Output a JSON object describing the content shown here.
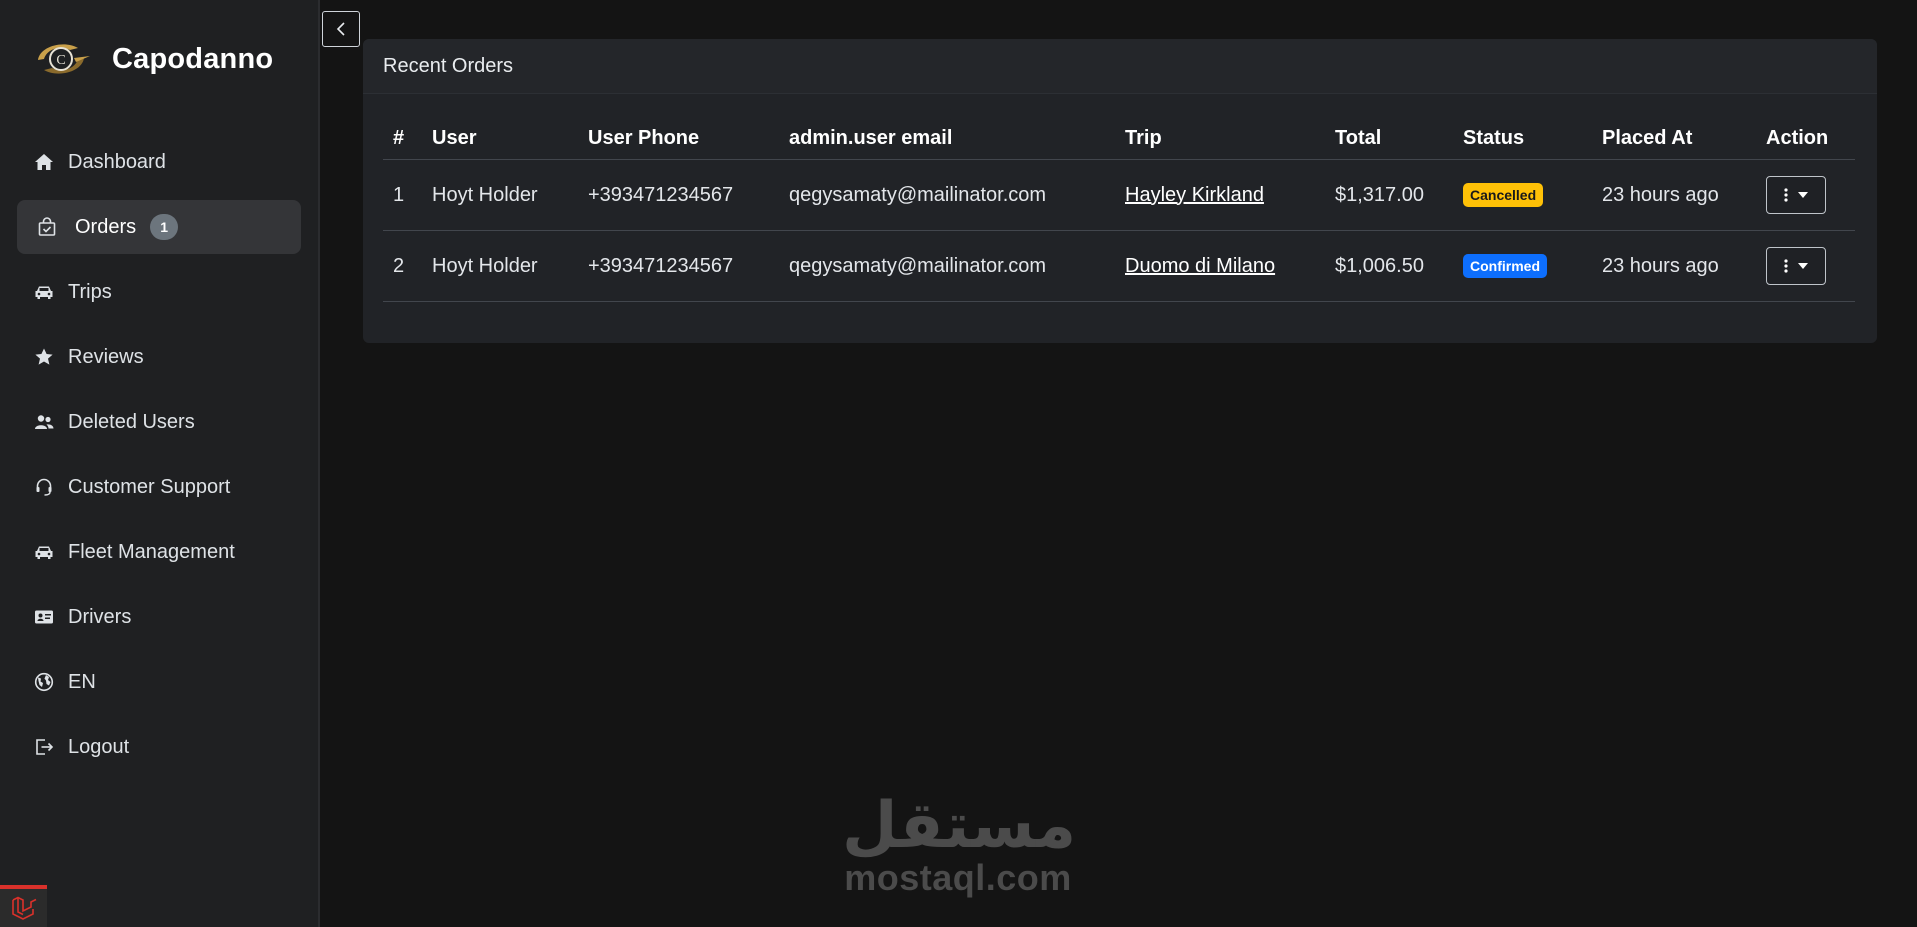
{
  "brand": {
    "name": "Capodanno"
  },
  "sidebar": {
    "items": [
      {
        "label": "Dashboard",
        "icon": "home-icon"
      },
      {
        "label": "Orders",
        "icon": "shopping-bag-icon",
        "badge": "1",
        "active": true
      },
      {
        "label": "Trips",
        "icon": "car-icon"
      },
      {
        "label": "Reviews",
        "icon": "star-icon"
      },
      {
        "label": "Deleted Users",
        "icon": "users-icon"
      },
      {
        "label": "Customer Support",
        "icon": "headset-icon"
      },
      {
        "label": "Fleet Management",
        "icon": "car-icon"
      },
      {
        "label": "Drivers",
        "icon": "id-card-icon"
      },
      {
        "label": "EN",
        "icon": "globe-icon"
      },
      {
        "label": "Logout",
        "icon": "logout-icon"
      }
    ]
  },
  "orders": {
    "title": "Recent Orders",
    "columns": [
      "#",
      "User",
      "User Phone",
      "admin.user email",
      "Trip",
      "Total",
      "Status",
      "Placed At",
      "Action"
    ],
    "rows": [
      {
        "index": "1",
        "user": "Hoyt Holder",
        "phone": "+393471234567",
        "email": "qegysamaty@mailinator.com",
        "trip": "Hayley Kirkland",
        "total": "$1,317.00",
        "status": "Cancelled",
        "placed_at": "23 hours ago"
      },
      {
        "index": "2",
        "user": "Hoyt Holder",
        "phone": "+393471234567",
        "email": "qegysamaty@mailinator.com",
        "trip": "Duomo di Milano",
        "total": "$1,006.50",
        "status": "Confirmed",
        "placed_at": "23 hours ago"
      }
    ]
  },
  "watermark": {
    "arabic": "مستقل",
    "latin": "mostaql.com"
  },
  "colors": {
    "cancelled": "#ffc107",
    "confirmed": "#0d6efd",
    "laravel": "#d9312b"
  }
}
